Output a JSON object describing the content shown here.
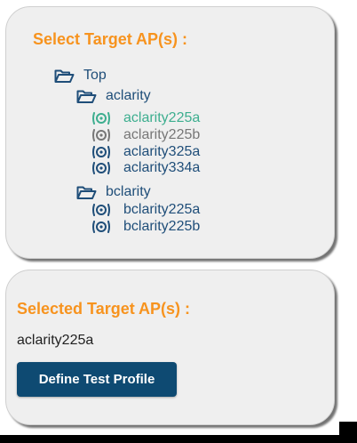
{
  "select_panel": {
    "title": "Select Target AP(s) :",
    "tree": {
      "root_label": "Top",
      "groups": [
        {
          "label": "aclarity",
          "aps": [
            {
              "name": "aclarity225a",
              "state": "active",
              "color": "#3dae8f"
            },
            {
              "name": "aclarity225b",
              "state": "offline",
              "color": "#777777"
            },
            {
              "name": "aclarity325a",
              "state": "online",
              "color": "#1f4e79"
            },
            {
              "name": "aclarity334a",
              "state": "online",
              "color": "#1f4e79"
            }
          ]
        },
        {
          "label": "bclarity",
          "aps": [
            {
              "name": "bclarity225a",
              "state": "online",
              "color": "#1f4e79"
            },
            {
              "name": "bclarity225b",
              "state": "online",
              "color": "#1f4e79"
            }
          ]
        }
      ]
    }
  },
  "selected_panel": {
    "title": "Selected Target AP(s) :",
    "value": "aclarity225a",
    "button_label": "Define Test Profile"
  },
  "colors": {
    "title_orange": "#f7931e",
    "tree_blue": "#1f4e79",
    "ap_active_green": "#3dae8f",
    "ap_offline_gray": "#777777",
    "button_bg": "#0e4a72",
    "panel_bg": "#efefef"
  },
  "icons": {
    "folder": "folder-open-icon",
    "ap": "access-point-icon"
  }
}
